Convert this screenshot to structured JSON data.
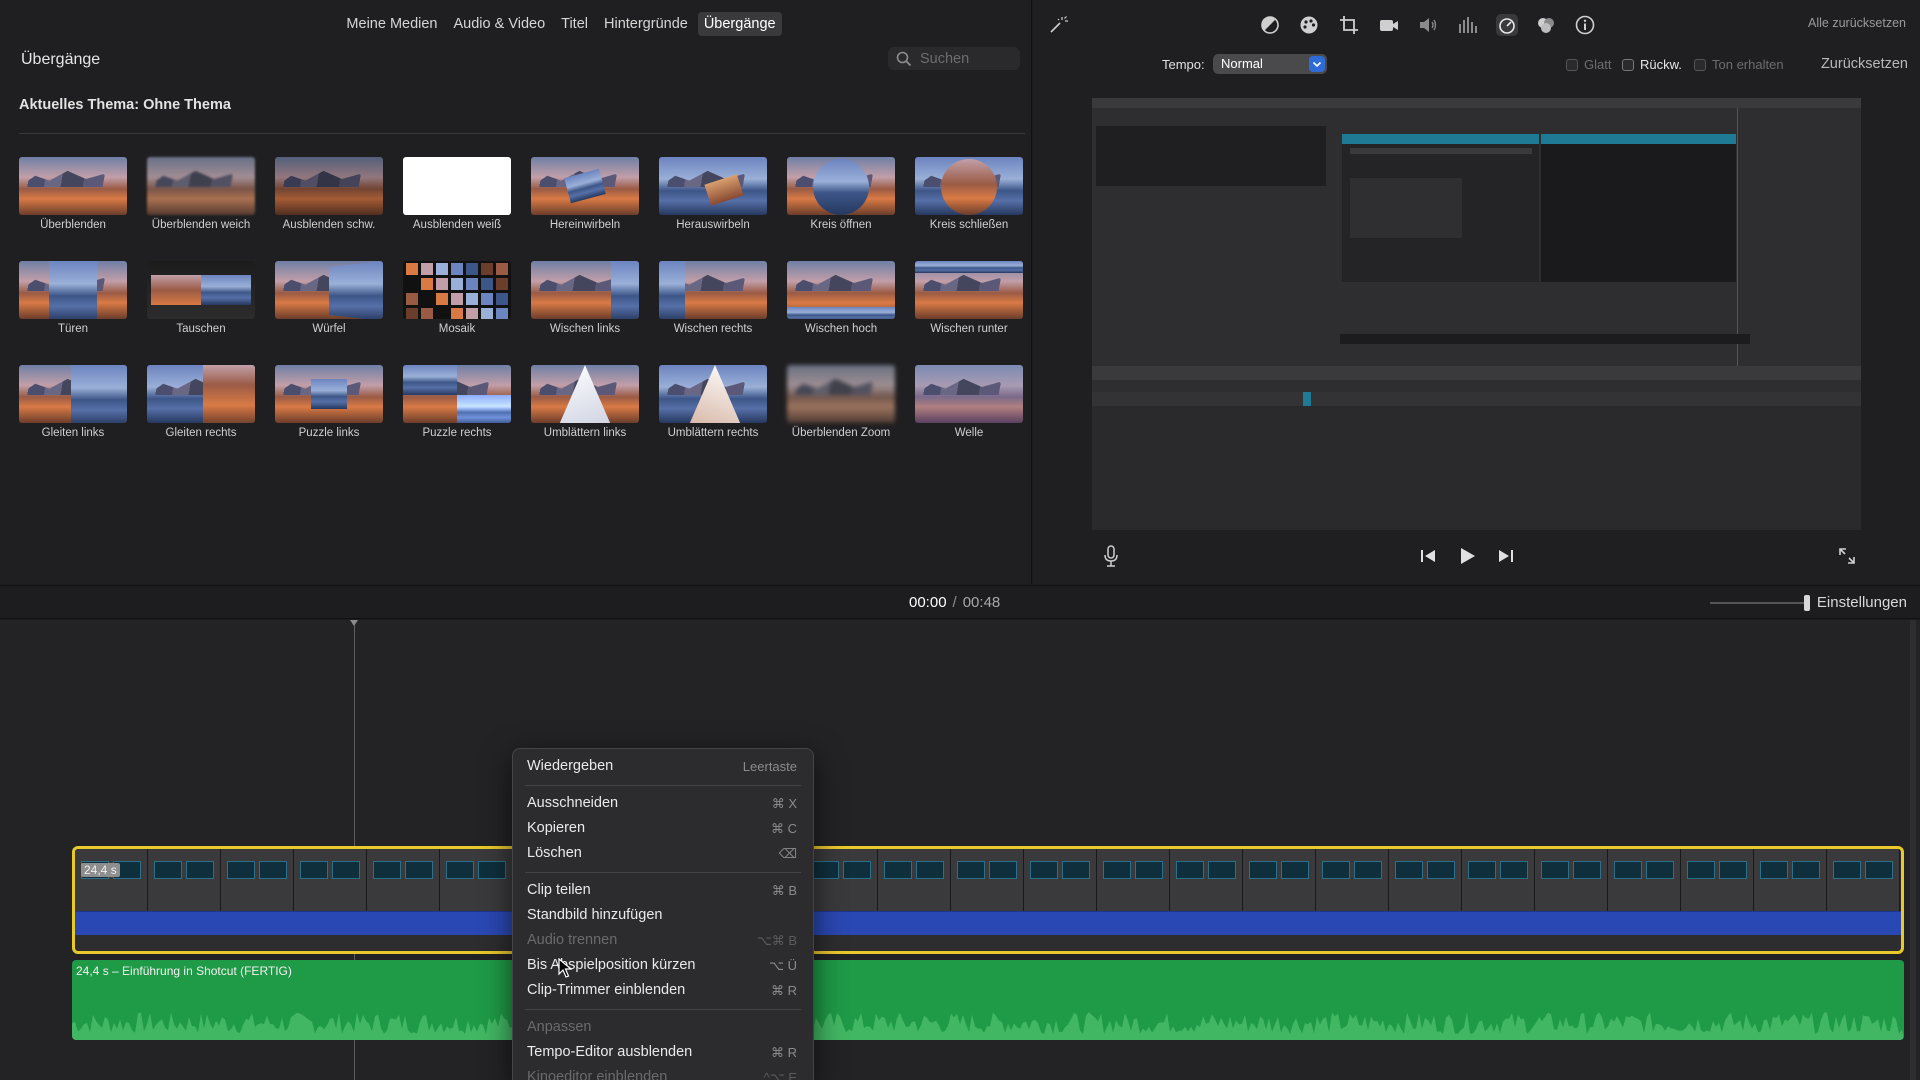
{
  "browser": {
    "tabs": [
      "Meine Medien",
      "Audio & Video",
      "Titel",
      "Hintergründe",
      "Übergänge"
    ],
    "active_tab": "Übergänge",
    "title": "Übergänge",
    "search_placeholder": "Suchen",
    "theme_label": "Aktuelles Thema: Ohne Thema",
    "transitions": [
      "Überblenden",
      "Überblenden weich",
      "Ausblenden schw.",
      "Ausblenden weiß",
      "Hereinwirbeln",
      "Herauswirbeln",
      "Kreis öffnen",
      "Kreis schließen",
      "Türen",
      "Tauschen",
      "Würfel",
      "Mosaik",
      "Wischen links",
      "Wischen rechts",
      "Wischen hoch",
      "Wischen runter",
      "Gleiten links",
      "Gleiten rechts",
      "Puzzle links",
      "Puzzle rechts",
      "Umblättern links",
      "Umblättern rechts",
      "Überblenden Zoom",
      "Welle"
    ]
  },
  "viewer": {
    "reset_all": "Alle zurücksetzen",
    "tempo_label": "Tempo:",
    "tempo_value": "Normal",
    "checkboxes": [
      "Glatt",
      "Rückw.",
      "Ton erhalten"
    ],
    "reset": "Zurücksetzen",
    "icons": [
      "magic-wand-icon",
      "color-balance-icon",
      "color-correction-icon",
      "crop-icon",
      "stabilization-icon",
      "volume-icon",
      "equalizer-icon",
      "speed-icon",
      "noise-reduction-icon",
      "info-icon"
    ]
  },
  "timeline_bar": {
    "current": "00:00",
    "separator": "/",
    "total": "00:48",
    "settings": "Einstellungen"
  },
  "timeline": {
    "clip_duration": "24,4 s",
    "audio_clip_name": "24,4 s – Einführung in Shotcut (FERTIG)"
  },
  "context_menu": {
    "groups": [
      [
        {
          "label": "Wiedergeben",
          "shortcut": "Leertaste",
          "enabled": true
        }
      ],
      [
        {
          "label": "Ausschneiden",
          "shortcut": "⌘ X",
          "enabled": true
        },
        {
          "label": "Kopieren",
          "shortcut": "⌘ C",
          "enabled": true
        },
        {
          "label": "Löschen",
          "shortcut": "⌫",
          "enabled": true
        }
      ],
      [
        {
          "label": "Clip teilen",
          "shortcut": "⌘ B",
          "enabled": true
        },
        {
          "label": "Standbild hinzufügen",
          "shortcut": "",
          "enabled": true
        },
        {
          "label": "Audio trennen",
          "shortcut": "⌥⌘ B",
          "enabled": false
        },
        {
          "label": "Bis Abspielposition kürzen",
          "shortcut": "⌥ Ü",
          "enabled": true
        },
        {
          "label": "Clip-Trimmer einblenden",
          "shortcut": "⌘ R",
          "enabled": true
        }
      ],
      [
        {
          "label": "Anpassen",
          "shortcut": "",
          "enabled": false
        },
        {
          "label": "Tempo-Editor ausblenden",
          "shortcut": "⌘ R",
          "enabled": true
        },
        {
          "label": "Kinoeditor einblenden",
          "shortcut": "^⌥ E",
          "enabled": false
        }
      ]
    ]
  },
  "colors": {
    "accent_blue": "#2f6bd6",
    "clip_border": "#e9c82a",
    "audio_green": "#1f9a46",
    "audio_strip_blue": "#2a48b3"
  }
}
